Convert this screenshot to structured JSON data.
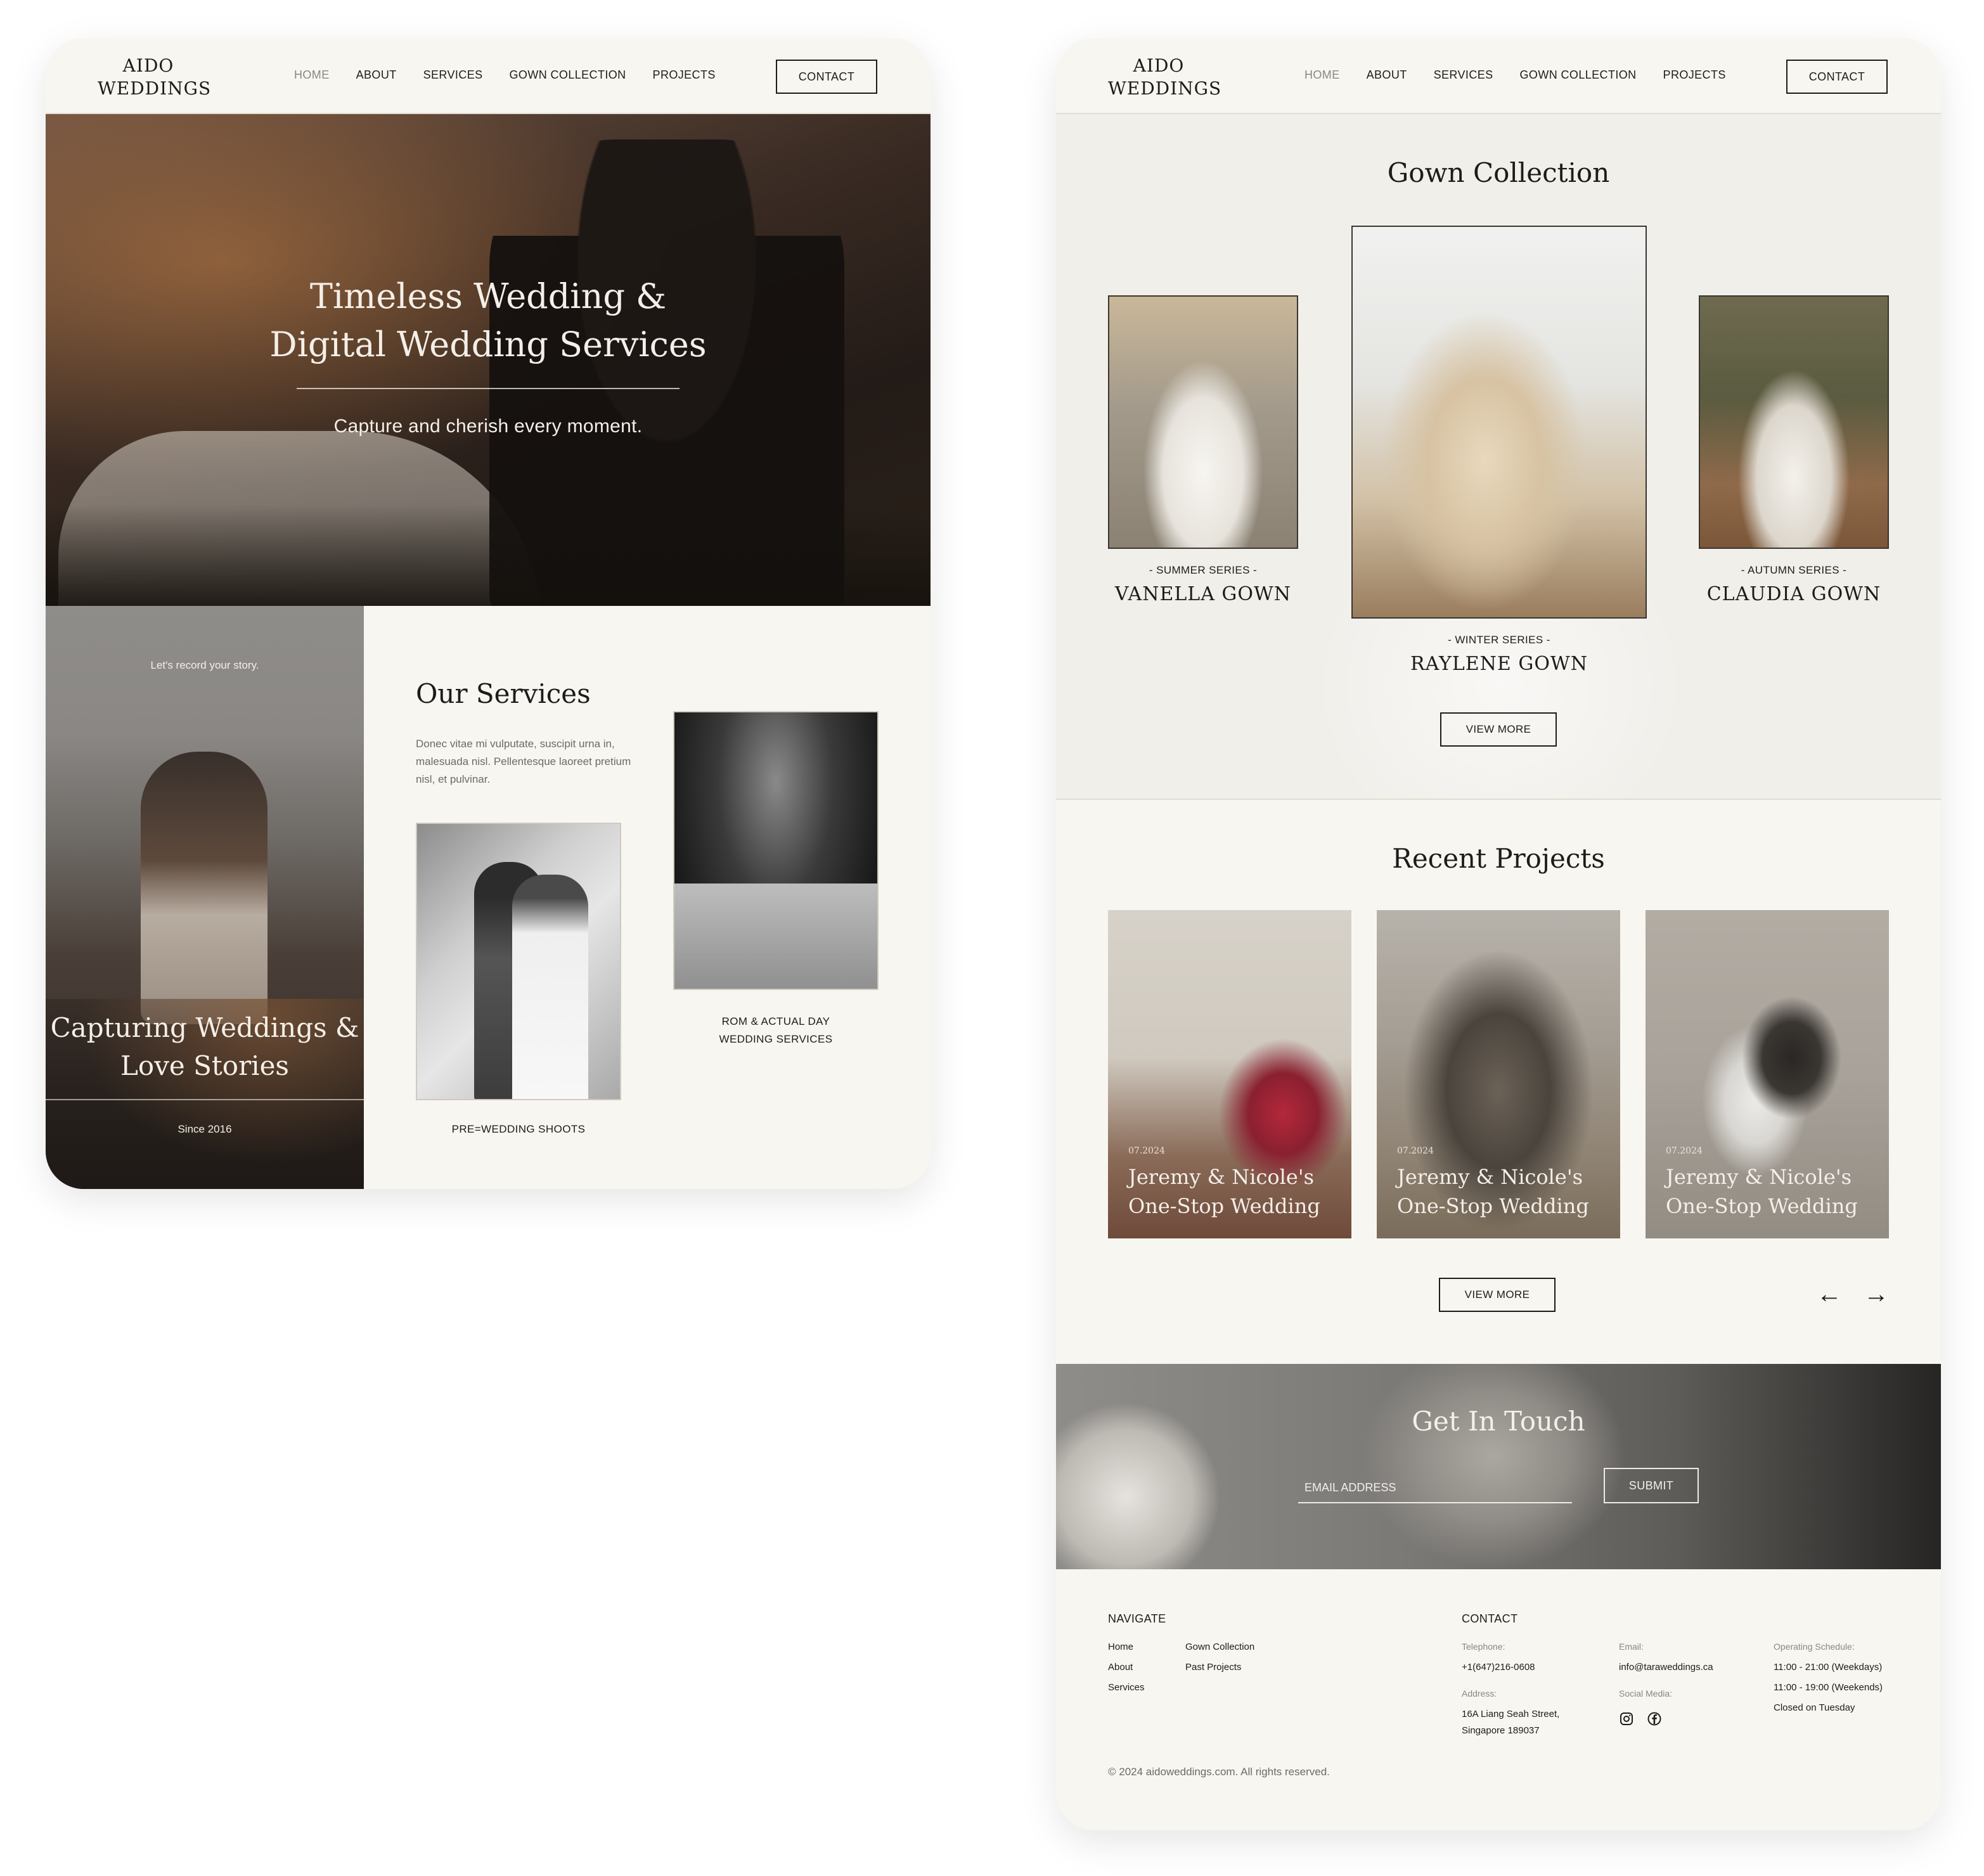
{
  "brand": {
    "logo_line1": "AIDO",
    "logo_line2": "WEDDINGS"
  },
  "nav": {
    "items": [
      "HOME",
      "ABOUT",
      "SERVICES",
      "GOWN COLLECTION",
      "PROJECTS"
    ],
    "active": "HOME",
    "contact_label": "CONTACT"
  },
  "hero": {
    "title_line1": "Timeless Wedding &",
    "title_line2": "Digital Wedding Services",
    "subtitle": "Capture and cherish every moment."
  },
  "story": {
    "tagline": "Let's record your story.",
    "title_line1": "Capturing Weddings &",
    "title_line2": "Love Stories",
    "since": "Since 2016"
  },
  "services": {
    "title": "Our Services",
    "description": "Donec vitae mi vulputate, suscipit urna in, malesuada nisl. Pellentesque laoreet pretium nisl, et pulvinar.",
    "items": [
      {
        "caption": "PRE=WEDDING SHOOTS"
      },
      {
        "caption_line1": "ROM & ACTUAL DAY",
        "caption_line2": "WEDDING SERVICES"
      }
    ]
  },
  "gowns": {
    "title": "Gown Collection",
    "items": [
      {
        "series": "- SUMMER SERIES -",
        "name": "VANELLA GOWN"
      },
      {
        "series": "- WINTER SERIES -",
        "name": "RAYLENE GOWN"
      },
      {
        "series": "- AUTUMN SERIES -",
        "name": "CLAUDIA GOWN"
      }
    ],
    "view_more": "VIEW MORE"
  },
  "projects": {
    "title": "Recent Projects",
    "items": [
      {
        "date": "07.2024",
        "title_line1": "Jeremy & Nicole's",
        "title_line2": "One-Stop Wedding"
      },
      {
        "date": "07.2024",
        "title_line1": "Jeremy & Nicole's",
        "title_line2": "One-Stop Wedding"
      },
      {
        "date": "07.2024",
        "title_line1": "Jeremy & Nicole's",
        "title_line2": "One-Stop Wedding"
      }
    ],
    "view_more": "VIEW MORE",
    "prev_icon": "arrow-left-icon",
    "next_icon": "arrow-right-icon"
  },
  "touch": {
    "title": "Get In Touch",
    "email_placeholder": "EMAIL ADDRESS",
    "submit_label": "SUBMIT"
  },
  "footer": {
    "navigate_title": "NAVIGATE",
    "nav_col1": [
      "Home",
      "About",
      "Services"
    ],
    "nav_col2": [
      "Gown Collection",
      "Past Projects"
    ],
    "contact_title": "CONTACT",
    "telephone_label": "Telephone:",
    "telephone": "+1(647)216-0608",
    "address_label": "Address:",
    "address_line1": "16A Liang Seah Street,",
    "address_line2": "Singapore 189037",
    "email_label": "Email:",
    "email": "info@taraweddings.ca",
    "social_label": "Social Media:",
    "social_icons": [
      "instagram-icon",
      "facebook-icon"
    ],
    "schedule_label": "Operating Schedule:",
    "schedule": [
      "11:00 - 21:00 (Weekdays)",
      "11:00 - 19:00 (Weekends)",
      "Closed on Tuesday"
    ],
    "copyright": "© 2024 aidoweddings.com. All rights reserved."
  },
  "colors": {
    "cream": "#f8f6f0",
    "ink": "#1e1c1a",
    "muted": "#8b8680"
  }
}
